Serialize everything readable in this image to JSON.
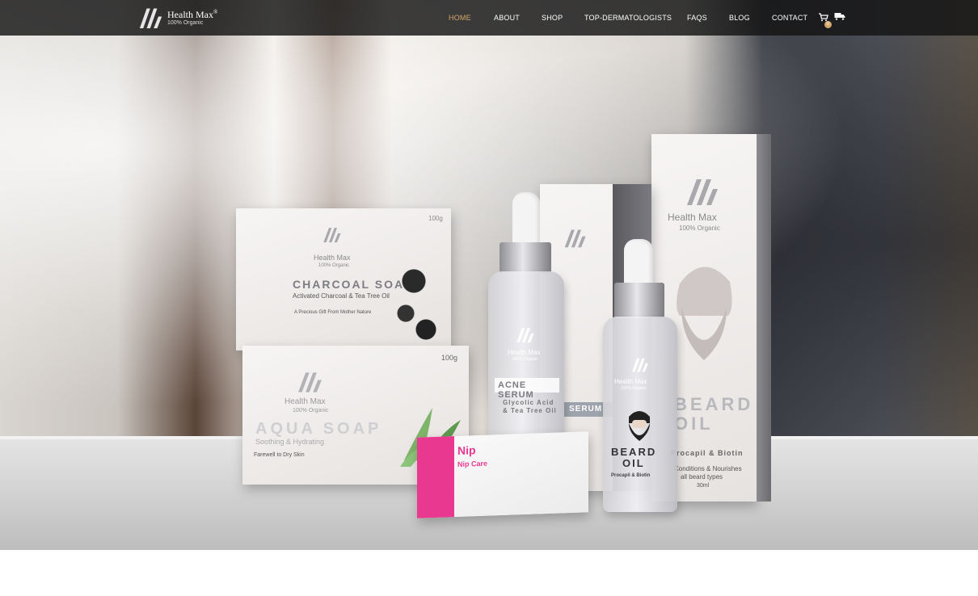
{
  "brand": {
    "name": "Health Max",
    "registered": "®",
    "tagline": "100% Organic"
  },
  "nav": {
    "items": [
      {
        "label": "HOME",
        "active": true
      },
      {
        "label": "ABOUT"
      },
      {
        "label": "SHOP"
      },
      {
        "label": "TOP-DERMATOLOGISTS"
      },
      {
        "label": "FAQS"
      },
      {
        "label": "BLOG"
      },
      {
        "label": "CONTACT"
      }
    ],
    "cart_count": "0",
    "icons": [
      "cart-icon",
      "delivery-truck-icon"
    ]
  },
  "hero": {
    "products": {
      "charcoal": {
        "weight": "100g",
        "brand": "Health Max",
        "sub": "100% Organic",
        "title": "CHARCOAL SOAP",
        "subtitle": "Activated Charcoal & Tea Tree Oil",
        "tagline": "A Precious Gift From Mother Nature"
      },
      "aqua": {
        "weight": "100g",
        "brand": "Health Max",
        "sub": "100% Organic",
        "title": "AQUA SOAP",
        "subtitle": "Soothing & Hydrating",
        "tagline": "Farewell to Dry Skin"
      },
      "acne": {
        "brand": "Health Max",
        "sub": "100% Organic",
        "title": "ACNE SERUM",
        "line1": "Glycolic Acid",
        "line2": "& Tea Tree Oil",
        "box_label": "SERUM"
      },
      "beard": {
        "brand": "Health Max",
        "sub": "100% Organic",
        "title": "BEARD",
        "title2": "OIL",
        "line1": "Procapil & Biotin",
        "box_line1": "Conditions & Nourishes",
        "box_line2": "all beard types",
        "volume": "30ml"
      },
      "nip": {
        "title": "Nip",
        "sub": "Nip Care"
      }
    }
  },
  "colors": {
    "accent": "#d4a86a",
    "nav_bg": "#1a1a1a"
  }
}
